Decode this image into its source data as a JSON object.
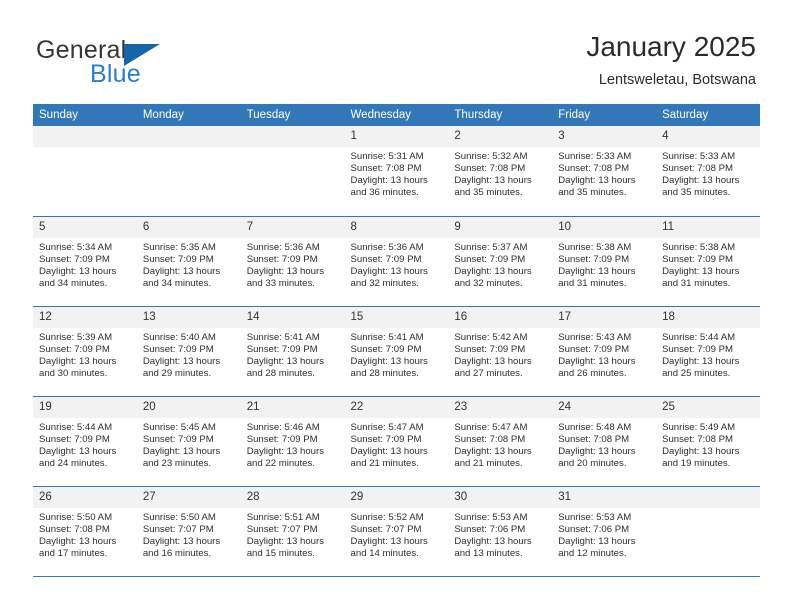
{
  "brand": {
    "word_one": "General",
    "word_two": "Blue",
    "flag_icon": "triangle-flag-icon"
  },
  "header": {
    "title": "January 2025",
    "subtitle": "Lentsweletau, Botswana"
  },
  "colors": {
    "header_blue": "#3277b8",
    "brand_blue": "#2a7fc9",
    "flag_blue": "#1565a8",
    "daynum_band": "#f2f2f2",
    "text": "#2e2e2e"
  },
  "calendar": {
    "weekdays": [
      "Sunday",
      "Monday",
      "Tuesday",
      "Wednesday",
      "Thursday",
      "Friday",
      "Saturday"
    ],
    "labels": {
      "sunrise": "Sunrise:",
      "sunset": "Sunset:",
      "daylight": "Daylight:"
    },
    "weeks": [
      [
        {
          "empty": true
        },
        {
          "empty": true
        },
        {
          "empty": true
        },
        {
          "day": "1",
          "sunrise": "Sunrise: 5:31 AM",
          "sunset": "Sunset: 7:08 PM",
          "daylight_a": "Daylight: 13 hours",
          "daylight_b": "and 36 minutes."
        },
        {
          "day": "2",
          "sunrise": "Sunrise: 5:32 AM",
          "sunset": "Sunset: 7:08 PM",
          "daylight_a": "Daylight: 13 hours",
          "daylight_b": "and 35 minutes."
        },
        {
          "day": "3",
          "sunrise": "Sunrise: 5:33 AM",
          "sunset": "Sunset: 7:08 PM",
          "daylight_a": "Daylight: 13 hours",
          "daylight_b": "and 35 minutes."
        },
        {
          "day": "4",
          "sunrise": "Sunrise: 5:33 AM",
          "sunset": "Sunset: 7:08 PM",
          "daylight_a": "Daylight: 13 hours",
          "daylight_b": "and 35 minutes."
        }
      ],
      [
        {
          "day": "5",
          "sunrise": "Sunrise: 5:34 AM",
          "sunset": "Sunset: 7:09 PM",
          "daylight_a": "Daylight: 13 hours",
          "daylight_b": "and 34 minutes."
        },
        {
          "day": "6",
          "sunrise": "Sunrise: 5:35 AM",
          "sunset": "Sunset: 7:09 PM",
          "daylight_a": "Daylight: 13 hours",
          "daylight_b": "and 34 minutes."
        },
        {
          "day": "7",
          "sunrise": "Sunrise: 5:36 AM",
          "sunset": "Sunset: 7:09 PM",
          "daylight_a": "Daylight: 13 hours",
          "daylight_b": "and 33 minutes."
        },
        {
          "day": "8",
          "sunrise": "Sunrise: 5:36 AM",
          "sunset": "Sunset: 7:09 PM",
          "daylight_a": "Daylight: 13 hours",
          "daylight_b": "and 32 minutes."
        },
        {
          "day": "9",
          "sunrise": "Sunrise: 5:37 AM",
          "sunset": "Sunset: 7:09 PM",
          "daylight_a": "Daylight: 13 hours",
          "daylight_b": "and 32 minutes."
        },
        {
          "day": "10",
          "sunrise": "Sunrise: 5:38 AM",
          "sunset": "Sunset: 7:09 PM",
          "daylight_a": "Daylight: 13 hours",
          "daylight_b": "and 31 minutes."
        },
        {
          "day": "11",
          "sunrise": "Sunrise: 5:38 AM",
          "sunset": "Sunset: 7:09 PM",
          "daylight_a": "Daylight: 13 hours",
          "daylight_b": "and 31 minutes."
        }
      ],
      [
        {
          "day": "12",
          "sunrise": "Sunrise: 5:39 AM",
          "sunset": "Sunset: 7:09 PM",
          "daylight_a": "Daylight: 13 hours",
          "daylight_b": "and 30 minutes."
        },
        {
          "day": "13",
          "sunrise": "Sunrise: 5:40 AM",
          "sunset": "Sunset: 7:09 PM",
          "daylight_a": "Daylight: 13 hours",
          "daylight_b": "and 29 minutes."
        },
        {
          "day": "14",
          "sunrise": "Sunrise: 5:41 AM",
          "sunset": "Sunset: 7:09 PM",
          "daylight_a": "Daylight: 13 hours",
          "daylight_b": "and 28 minutes."
        },
        {
          "day": "15",
          "sunrise": "Sunrise: 5:41 AM",
          "sunset": "Sunset: 7:09 PM",
          "daylight_a": "Daylight: 13 hours",
          "daylight_b": "and 28 minutes."
        },
        {
          "day": "16",
          "sunrise": "Sunrise: 5:42 AM",
          "sunset": "Sunset: 7:09 PM",
          "daylight_a": "Daylight: 13 hours",
          "daylight_b": "and 27 minutes."
        },
        {
          "day": "17",
          "sunrise": "Sunrise: 5:43 AM",
          "sunset": "Sunset: 7:09 PM",
          "daylight_a": "Daylight: 13 hours",
          "daylight_b": "and 26 minutes."
        },
        {
          "day": "18",
          "sunrise": "Sunrise: 5:44 AM",
          "sunset": "Sunset: 7:09 PM",
          "daylight_a": "Daylight: 13 hours",
          "daylight_b": "and 25 minutes."
        }
      ],
      [
        {
          "day": "19",
          "sunrise": "Sunrise: 5:44 AM",
          "sunset": "Sunset: 7:09 PM",
          "daylight_a": "Daylight: 13 hours",
          "daylight_b": "and 24 minutes."
        },
        {
          "day": "20",
          "sunrise": "Sunrise: 5:45 AM",
          "sunset": "Sunset: 7:09 PM",
          "daylight_a": "Daylight: 13 hours",
          "daylight_b": "and 23 minutes."
        },
        {
          "day": "21",
          "sunrise": "Sunrise: 5:46 AM",
          "sunset": "Sunset: 7:09 PM",
          "daylight_a": "Daylight: 13 hours",
          "daylight_b": "and 22 minutes."
        },
        {
          "day": "22",
          "sunrise": "Sunrise: 5:47 AM",
          "sunset": "Sunset: 7:09 PM",
          "daylight_a": "Daylight: 13 hours",
          "daylight_b": "and 21 minutes."
        },
        {
          "day": "23",
          "sunrise": "Sunrise: 5:47 AM",
          "sunset": "Sunset: 7:08 PM",
          "daylight_a": "Daylight: 13 hours",
          "daylight_b": "and 21 minutes."
        },
        {
          "day": "24",
          "sunrise": "Sunrise: 5:48 AM",
          "sunset": "Sunset: 7:08 PM",
          "daylight_a": "Daylight: 13 hours",
          "daylight_b": "and 20 minutes."
        },
        {
          "day": "25",
          "sunrise": "Sunrise: 5:49 AM",
          "sunset": "Sunset: 7:08 PM",
          "daylight_a": "Daylight: 13 hours",
          "daylight_b": "and 19 minutes."
        }
      ],
      [
        {
          "day": "26",
          "sunrise": "Sunrise: 5:50 AM",
          "sunset": "Sunset: 7:08 PM",
          "daylight_a": "Daylight: 13 hours",
          "daylight_b": "and 17 minutes."
        },
        {
          "day": "27",
          "sunrise": "Sunrise: 5:50 AM",
          "sunset": "Sunset: 7:07 PM",
          "daylight_a": "Daylight: 13 hours",
          "daylight_b": "and 16 minutes."
        },
        {
          "day": "28",
          "sunrise": "Sunrise: 5:51 AM",
          "sunset": "Sunset: 7:07 PM",
          "daylight_a": "Daylight: 13 hours",
          "daylight_b": "and 15 minutes."
        },
        {
          "day": "29",
          "sunrise": "Sunrise: 5:52 AM",
          "sunset": "Sunset: 7:07 PM",
          "daylight_a": "Daylight: 13 hours",
          "daylight_b": "and 14 minutes."
        },
        {
          "day": "30",
          "sunrise": "Sunrise: 5:53 AM",
          "sunset": "Sunset: 7:06 PM",
          "daylight_a": "Daylight: 13 hours",
          "daylight_b": "and 13 minutes."
        },
        {
          "day": "31",
          "sunrise": "Sunrise: 5:53 AM",
          "sunset": "Sunset: 7:06 PM",
          "daylight_a": "Daylight: 13 hours",
          "daylight_b": "and 12 minutes."
        },
        {
          "empty": true
        }
      ]
    ]
  }
}
